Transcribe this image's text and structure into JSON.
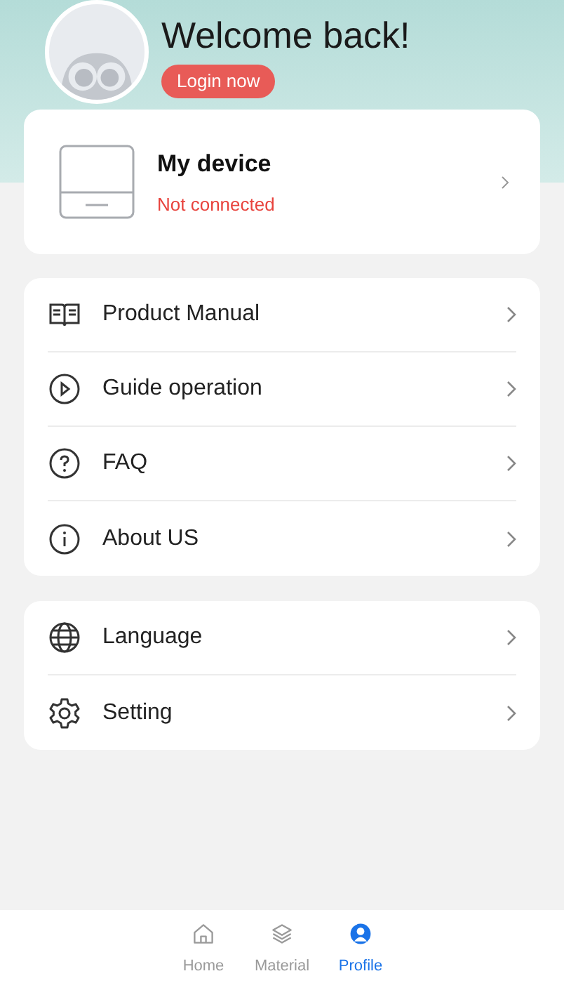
{
  "header": {
    "title": "Welcome back!",
    "login_button": "Login now"
  },
  "device": {
    "name": "My device",
    "status": "Not connected"
  },
  "menu_groups": [
    {
      "items": [
        {
          "label": "Product Manual"
        },
        {
          "label": "Guide operation"
        },
        {
          "label": "FAQ"
        },
        {
          "label": "About US"
        }
      ]
    },
    {
      "items": [
        {
          "label": "Language"
        },
        {
          "label": "Setting"
        }
      ]
    }
  ],
  "tab_bar": [
    {
      "label": "Home",
      "selected": false
    },
    {
      "label": "Material",
      "selected": false
    },
    {
      "label": "Profile",
      "selected": true
    }
  ]
}
